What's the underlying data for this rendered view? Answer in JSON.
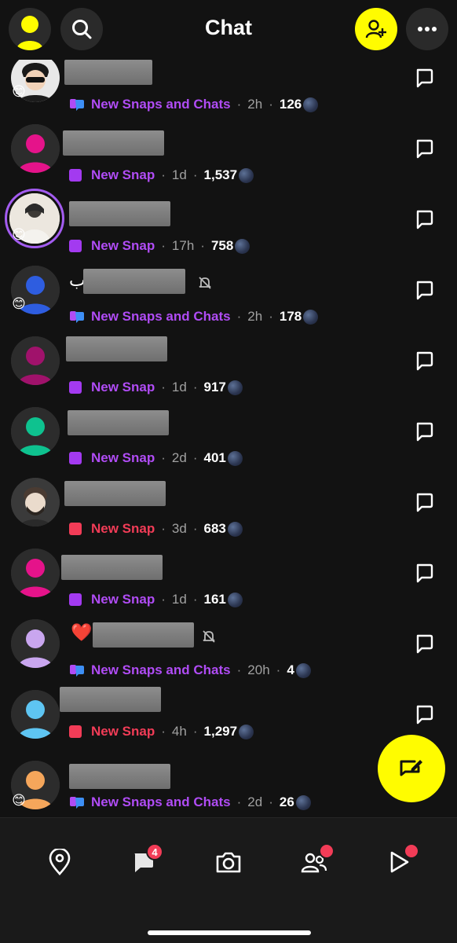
{
  "header": {
    "title": "Chat"
  },
  "chats": [
    {
      "extra": "",
      "muted": false,
      "status_type": "chat",
      "status": "New Snaps and Chats",
      "time": "2h",
      "streak": "126",
      "emoji": "😊",
      "avatar_color": "#2c2c2c"
    },
    {
      "extra": "",
      "muted": false,
      "status_type": "purple",
      "status": "New Snap",
      "time": "1d",
      "streak": "1,537",
      "emoji": "",
      "avatar_color": "#e5138a"
    },
    {
      "extra": "",
      "muted": false,
      "status_type": "purple",
      "status": "New Snap",
      "time": "17h",
      "streak": "758",
      "emoji": "😊",
      "avatar_color": "#e9e4dc"
    },
    {
      "extra": "ب",
      "muted": true,
      "status_type": "chat",
      "status": "New Snaps and Chats",
      "time": "2h",
      "streak": "178",
      "emoji": "😊",
      "avatar_color": "#2e5de0"
    },
    {
      "extra": "",
      "muted": false,
      "status_type": "purple",
      "status": "New Snap",
      "time": "1d",
      "streak": "917",
      "emoji": "",
      "avatar_color": "#a0126b"
    },
    {
      "extra": "",
      "muted": false,
      "status_type": "purple",
      "status": "New Snap",
      "time": "2d",
      "streak": "401",
      "emoji": "",
      "avatar_color": "#0ec28f"
    },
    {
      "extra": "",
      "muted": false,
      "status_type": "red",
      "status": "New Snap",
      "time": "3d",
      "streak": "683",
      "emoji": "",
      "avatar_color": "#3a3a3a"
    },
    {
      "extra": "",
      "muted": false,
      "status_type": "purple",
      "status": "New Snap",
      "time": "1d",
      "streak": "161",
      "emoji": "",
      "avatar_color": "#e5138a"
    },
    {
      "extra": "❤️",
      "muted": true,
      "status_type": "chat",
      "status": "New Snaps and Chats",
      "time": "20h",
      "streak": "4",
      "emoji": "",
      "avatar_color": "#c9a6ef"
    },
    {
      "extra": "",
      "muted": false,
      "status_type": "red",
      "status": "New Snap",
      "time": "4h",
      "streak": "1,297",
      "emoji": "",
      "avatar_color": "#5ec5f2"
    },
    {
      "extra": "",
      "muted": false,
      "status_type": "chat",
      "status": "New Snaps and Chats",
      "time": "2d",
      "streak": "26",
      "emoji": "😊",
      "avatar_color": "#f5a65b"
    }
  ],
  "nav": {
    "chat_badge": "4"
  },
  "colors": {
    "accent_yellow": "#fffc00",
    "snap_purple": "#a33af0",
    "snap_red": "#f23c57",
    "chat_blue": "#3d8ff5"
  }
}
